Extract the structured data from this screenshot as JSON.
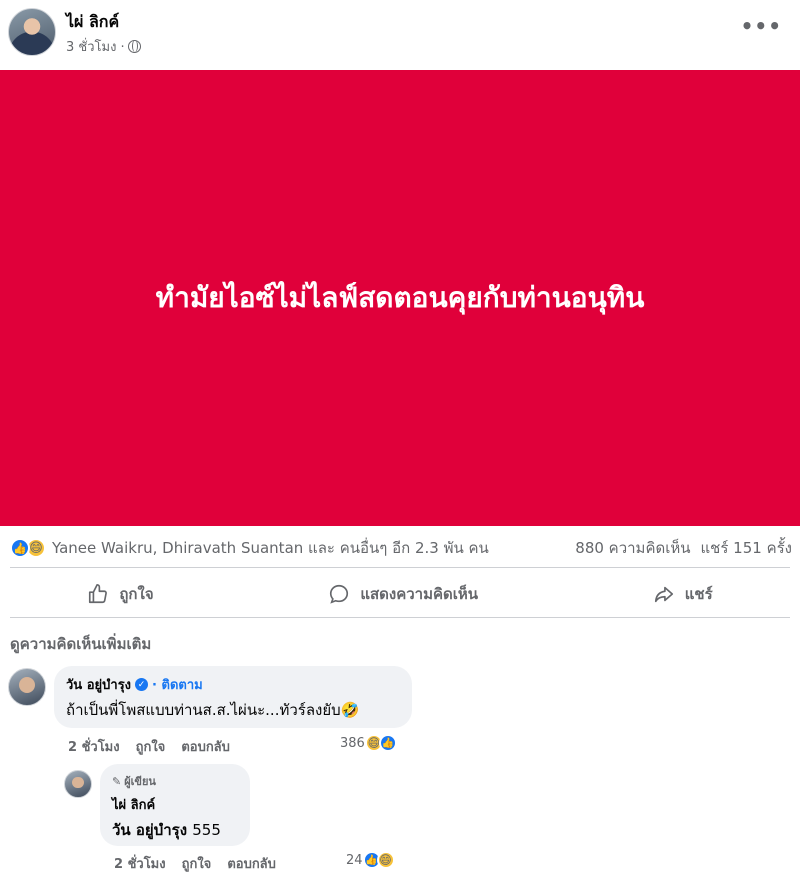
{
  "post": {
    "author": "ไผ่ ลิกค์",
    "time": "3 ชั่วโมง ·",
    "more_label": "•••"
  },
  "banner": {
    "text": "ทำมัยไอซ์ไม่ไลฟ์สดตอนคุยกับท่านอนุทิน",
    "color": "#e0003a"
  },
  "stats": {
    "reactors": "Yanee Waikru, Dhiravath Suantan และ คนอื่นๆ อีก 2.3 พัน คน",
    "comments": "880 ความคิดเห็น",
    "shares": "แชร์ 151 ครั้ง"
  },
  "actions": {
    "like": "ถูกใจ",
    "comment": "แสดงความคิดเห็น",
    "share": "แชร์"
  },
  "more_comments": "ดูความคิดเห็นเพิ่มเติม",
  "comments": [
    {
      "name": "วัน อยู่บำรุง",
      "follow": "· ติดตาม",
      "text": "ถ้าเป็นพี่โพสแบบท่านส.ส.ไผ่นะ...ทัวร์ลงยับ🤣",
      "time": "2 ชั่วโมง",
      "like": "ถูกใจ",
      "reply": "ตอบกลับ",
      "reaction_count": "386"
    }
  ],
  "reply": {
    "author_tag": "ผู้เขียน",
    "name": "ไผ่ ลิกค์",
    "mention": "วัน อยู่บำรุง",
    "text": "555",
    "time": "2 ชั่วโมง",
    "like": "ถูกใจ",
    "reply": "ตอบกลับ",
    "reaction_count": "24"
  }
}
